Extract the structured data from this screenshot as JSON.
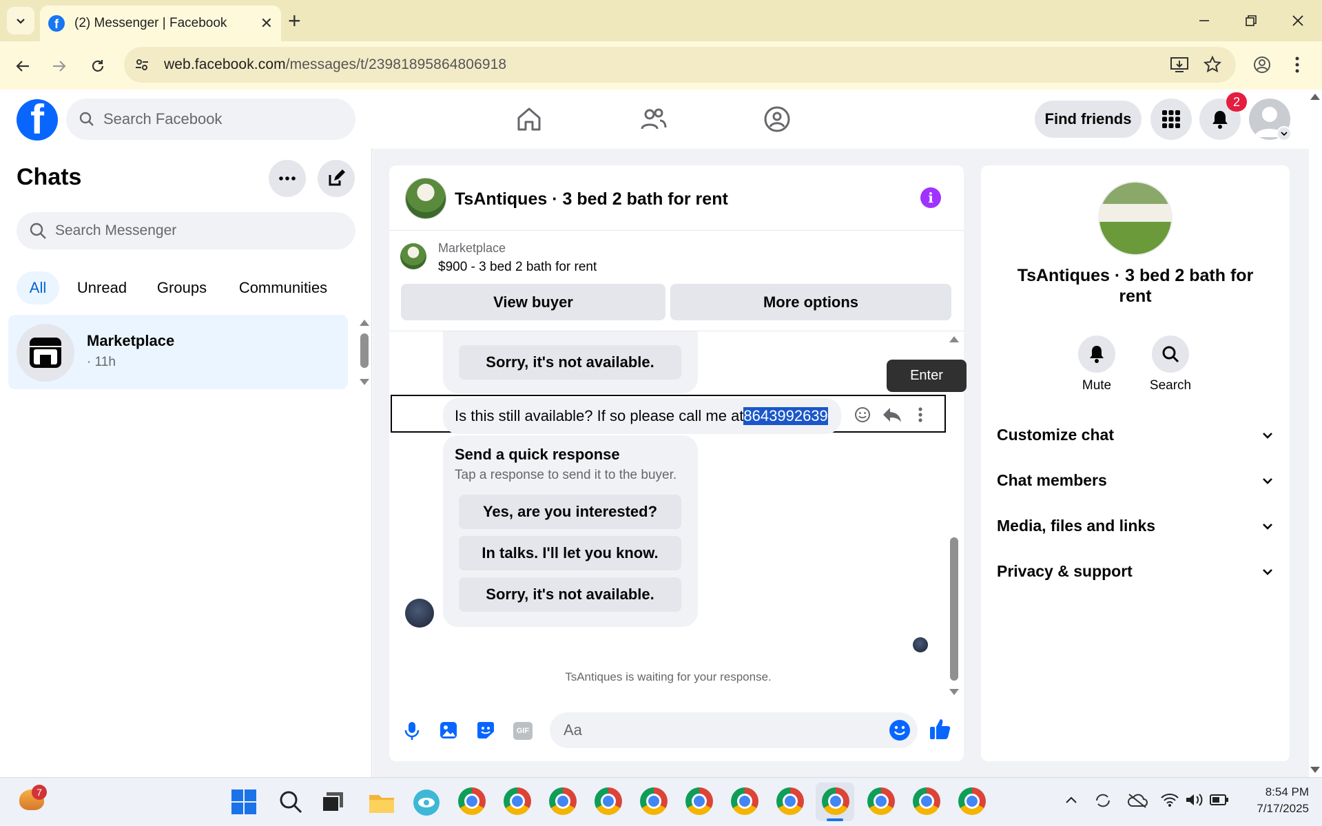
{
  "browser": {
    "tab_title": "(2) Messenger | Facebook",
    "new_tab": "+",
    "url_host": "web.facebook.com",
    "url_path": "/messages/t/23981895864806918"
  },
  "header": {
    "search_placeholder": "Search Facebook",
    "find_friends": "Find friends",
    "notifications_count": "2"
  },
  "sidebar": {
    "title": "Chats",
    "search_placeholder": "Search Messenger",
    "filters": [
      "All",
      "Unread",
      "Groups",
      "Communities"
    ],
    "chat": {
      "name": "Marketplace",
      "time": "· 11h"
    }
  },
  "conversation": {
    "title": "TsAntiques · 3 bed 2 bath for rent",
    "listing_source": "Marketplace",
    "listing_desc": "$900 - 3 bed 2 bath for rent",
    "view_buyer": "View buyer",
    "more_options": "More options",
    "top_quick_reply": "Sorry, it's not available.",
    "message_text": "Is this still available? If so please call me at ",
    "message_phone": "8643992639",
    "tooltip": "Enter",
    "quick_title": "Send a quick response",
    "quick_sub": "Tap a response to send it to the buyer.",
    "quick_replies": [
      "Yes, are you interested?",
      "In talks. I'll let you know.",
      "Sorry, it's not available."
    ],
    "waiting": "TsAntiques is waiting for your response.",
    "composer_placeholder": "Aa"
  },
  "right_panel": {
    "name": "TsAntiques · 3 bed 2 bath for rent",
    "mute": "Mute",
    "search": "Search",
    "sections": [
      "Customize chat",
      "Chat members",
      "Media, files and links",
      "Privacy & support"
    ]
  },
  "taskbar": {
    "weather_badge": "7",
    "time": "8:54 PM",
    "date": "7/17/2025"
  },
  "colors": {
    "fb_blue": "#0866ff",
    "highlight": "#1a57c9",
    "tab_strip": "#f0e8bd"
  }
}
